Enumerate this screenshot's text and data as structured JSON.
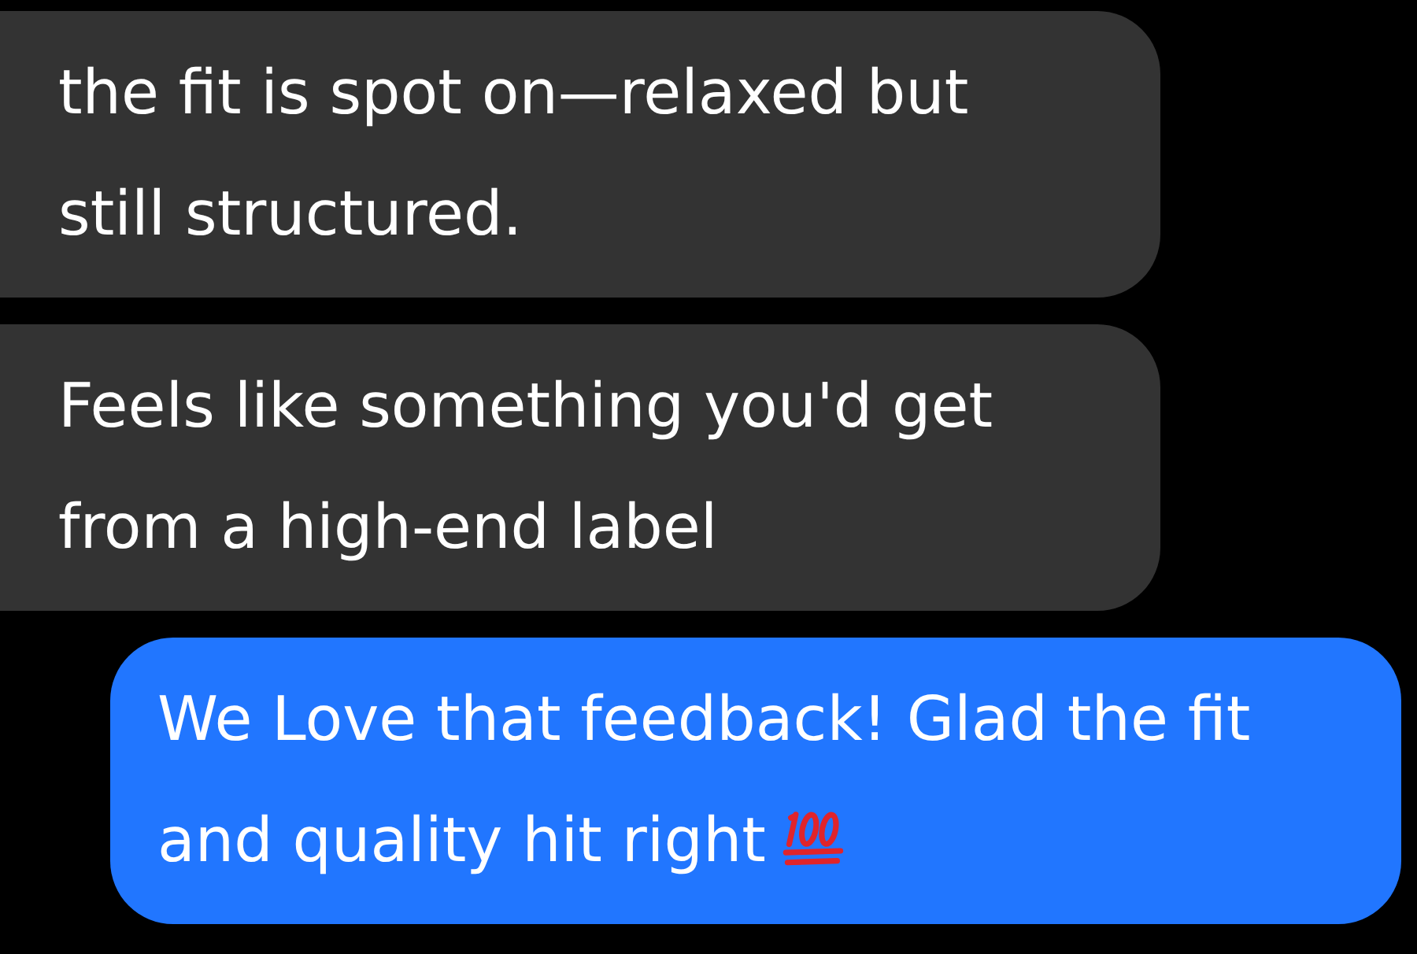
{
  "messages": [
    {
      "kind": "incoming",
      "text": "the fit is spot on—relaxed but still structured."
    },
    {
      "kind": "incoming",
      "text": "Feels like something you'd get from a high-end label"
    },
    {
      "kind": "outgoing",
      "text": "We Love that feedback! Glad the fit and quality hit right",
      "emoji_icon": true
    }
  ]
}
